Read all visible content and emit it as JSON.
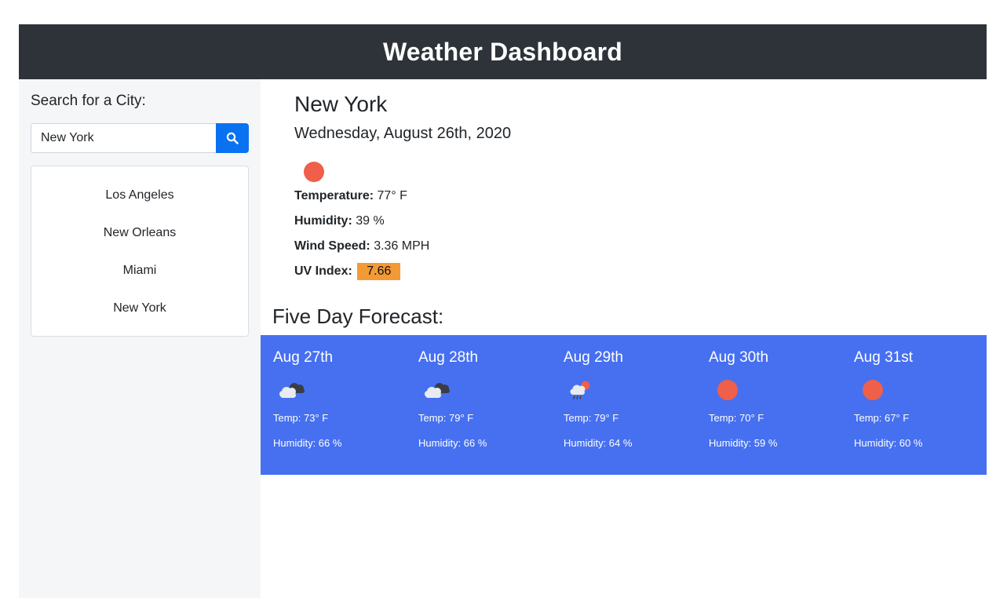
{
  "header": {
    "title": "Weather Dashboard"
  },
  "sidebar": {
    "search_title": "Search for a City:",
    "search_value": "New York",
    "search_icon": "search-icon",
    "cities": [
      "Los Angeles",
      "New Orleans",
      "Miami",
      "New York"
    ]
  },
  "current": {
    "city": "New York",
    "date": "Wednesday, August 26th, 2020",
    "icon": "sun-icon",
    "temperature_label": "Temperature:",
    "temperature_value": "77° F",
    "humidity_label": "Humidity:",
    "humidity_value": "39 %",
    "wind_label": "Wind Speed:",
    "wind_value": "3.36 MPH",
    "uv_label": "UV Index:",
    "uv_value": "7.66"
  },
  "forecast": {
    "title": "Five Day Forecast:",
    "days": [
      {
        "date": "Aug 27th",
        "icon": "broken-clouds-icon",
        "temp": "Temp: 73° F",
        "humidity": "Humidity: 66 %"
      },
      {
        "date": "Aug 28th",
        "icon": "broken-clouds-icon",
        "temp": "Temp: 79° F",
        "humidity": "Humidity: 66 %"
      },
      {
        "date": "Aug 29th",
        "icon": "rain-icon",
        "temp": "Temp: 79° F",
        "humidity": "Humidity: 64 %"
      },
      {
        "date": "Aug 30th",
        "icon": "sun-icon",
        "temp": "Temp: 70° F",
        "humidity": "Humidity: 59 %"
      },
      {
        "date": "Aug 31st",
        "icon": "sun-icon",
        "temp": "Temp: 67° F",
        "humidity": "Humidity: 60 %"
      }
    ]
  },
  "colors": {
    "header_bg": "#2e3239",
    "sidebar_bg": "#f5f6f8",
    "search_button": "#0a72f0",
    "forecast_bg": "#4670f0",
    "uv_badge": "#f39a35",
    "sun": "#ef5f4a"
  }
}
